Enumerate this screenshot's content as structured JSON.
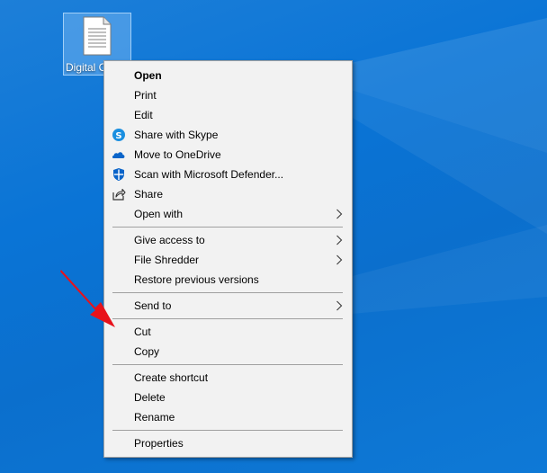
{
  "desktop": {
    "file_icon": {
      "label": "Digital C",
      "icon": "document-icon"
    }
  },
  "menu": {
    "items": [
      {
        "id": "open",
        "label": "Open",
        "bold": true
      },
      {
        "id": "print",
        "label": "Print"
      },
      {
        "id": "edit",
        "label": "Edit"
      },
      {
        "id": "share-skype",
        "label": "Share with Skype",
        "icon": "skype-icon",
        "color": "#00aff0"
      },
      {
        "id": "move-onedrive",
        "label": "Move to OneDrive",
        "icon": "onedrive-icon",
        "color": "#0a64c9"
      },
      {
        "id": "scan-defender",
        "label": "Scan with Microsoft Defender...",
        "icon": "defender-icon",
        "color": "#0a64c9"
      },
      {
        "id": "share",
        "label": "Share",
        "icon": "share-icon"
      },
      {
        "id": "open-with",
        "label": "Open with",
        "submenu": true
      },
      {
        "id": "give-access",
        "label": "Give access to",
        "submenu": true
      },
      {
        "id": "file-shredder",
        "label": "File Shredder",
        "submenu": true
      },
      {
        "id": "restore-versions",
        "label": "Restore previous versions"
      },
      {
        "id": "send-to",
        "label": "Send to",
        "submenu": true
      },
      {
        "id": "cut",
        "label": "Cut"
      },
      {
        "id": "copy",
        "label": "Copy"
      },
      {
        "id": "create-shortcut",
        "label": "Create shortcut"
      },
      {
        "id": "delete",
        "label": "Delete"
      },
      {
        "id": "rename",
        "label": "Rename"
      },
      {
        "id": "properties",
        "label": "Properties"
      }
    ]
  },
  "annotation": {
    "arrow_color": "#e8121b",
    "points_to": "Cut"
  },
  "colors": {
    "desktop_bg": "#0b6fcd",
    "menu_bg": "#f2f2f2",
    "separator": "#a0a0a0"
  }
}
